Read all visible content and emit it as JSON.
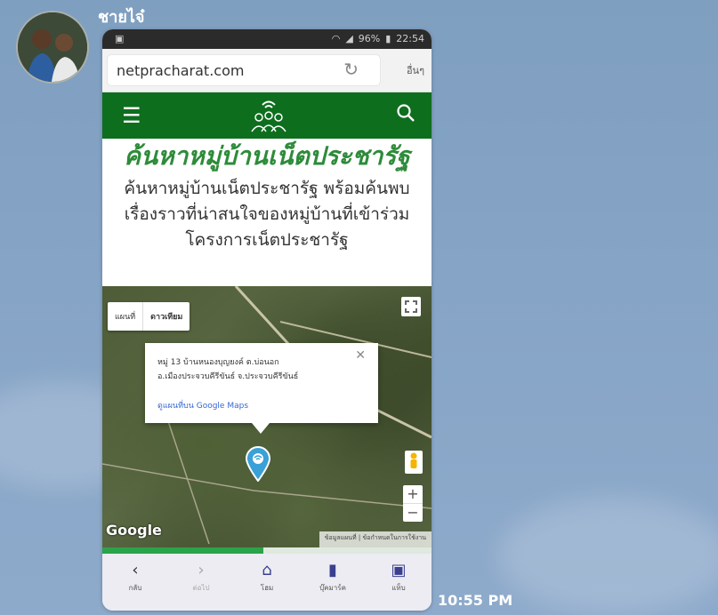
{
  "chat": {
    "sender_name": "ชายไจ๋",
    "message_time": "10:55 PM"
  },
  "status_bar": {
    "battery": "96%",
    "clock": "22:54"
  },
  "browser": {
    "url": "netpracharat.com",
    "more_label": "อื่นๆ"
  },
  "page": {
    "title": "ค้นหาหมู่บ้านเน็ตประชารัฐ",
    "description": "ค้นหาหมู่บ้านเน็ตประชารัฐ พร้อมค้นพบ เรื่องราวที่น่าสนใจของหมู่บ้านที่เข้าร่วม โครงการเน็ตประชารัฐ"
  },
  "map": {
    "map_type_options": [
      "แผนที่",
      "ดาวเทียม"
    ],
    "selected_map_type": "ดาวเทียม",
    "info_line1": "หมู่ 13 บ้านหนองบุญยงค์ ต.บ่อนอก",
    "info_line2": "อ.เมืองประจวบคีรีขันธ์ จ.ประจวบคีรีขันธ์",
    "info_link": "ดูแผนที่บน Google Maps",
    "google_label": "Google",
    "attribution": "ข้อมูลแผนที่ | ข้อกำหนดในการใช้งาน",
    "zoom_in": "+",
    "zoom_out": "−"
  },
  "load_progress": 0.49,
  "bottom_nav": [
    {
      "icon": "back-icon",
      "glyph": "‹",
      "label": "กลับ"
    },
    {
      "icon": "forward-icon",
      "glyph": "›",
      "label": "ต่อไป"
    },
    {
      "icon": "home-icon",
      "glyph": "⌂",
      "label": "โฮม"
    },
    {
      "icon": "bookmark-icon",
      "glyph": "▮",
      "label": "บุ๊คมาร์ค"
    },
    {
      "icon": "tabs-icon",
      "glyph": "▣",
      "label": "แท็บ"
    }
  ],
  "colors": {
    "header_green": "#0d6e1e",
    "title_green": "#2e8b3a",
    "pin_blue": "#3aa0d8"
  }
}
